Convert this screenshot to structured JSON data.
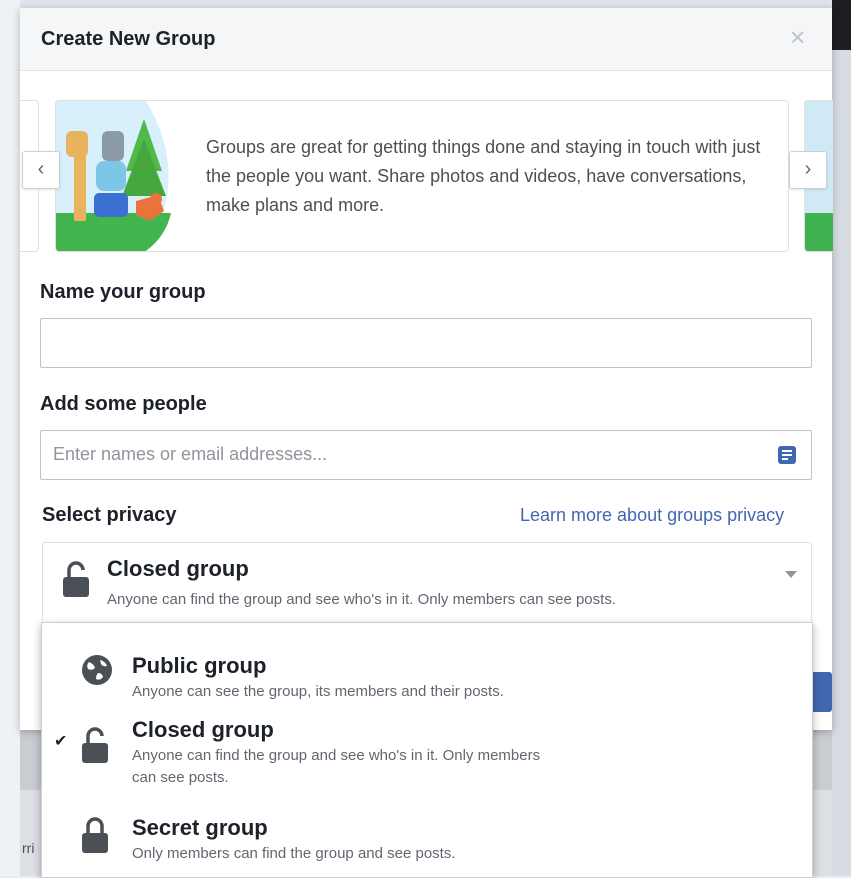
{
  "dialog": {
    "title": "Create New Group",
    "close_label": "×"
  },
  "carousel": {
    "text": "Groups are great for getting things done and staying in touch with just the people you want. Share photos and videos, have conversations, make plans and more.",
    "prev_label": "‹",
    "next_label": "›"
  },
  "name_section": {
    "label": "Name your group",
    "value": "",
    "placeholder": ""
  },
  "people_section": {
    "label": "Add some people",
    "placeholder": "Enter names or email addresses..."
  },
  "privacy": {
    "label": "Select privacy",
    "learn_more": "Learn more about groups privacy",
    "selected_title": "Closed group",
    "selected_desc": "Anyone can find the group and see who's in it. Only members can see posts.",
    "options": [
      {
        "title": "Public group",
        "desc": "Anyone can see the group, its members and their posts.",
        "icon": "globe-icon",
        "checked": false
      },
      {
        "title": "Closed group",
        "desc": "Anyone can find the group and see who's in it. Only members can see posts.",
        "icon": "lock-open-icon",
        "checked": true
      },
      {
        "title": "Secret group",
        "desc": "Only members can find the group and see posts.",
        "icon": "lock-closed-icon",
        "checked": false
      }
    ],
    "check_mark": "✔"
  },
  "background": {
    "partial_text": "rri"
  },
  "colors": {
    "link": "#4267b2",
    "text": "#1d2129",
    "secondary_text": "#606770",
    "header_bg": "#f5f6f7"
  }
}
